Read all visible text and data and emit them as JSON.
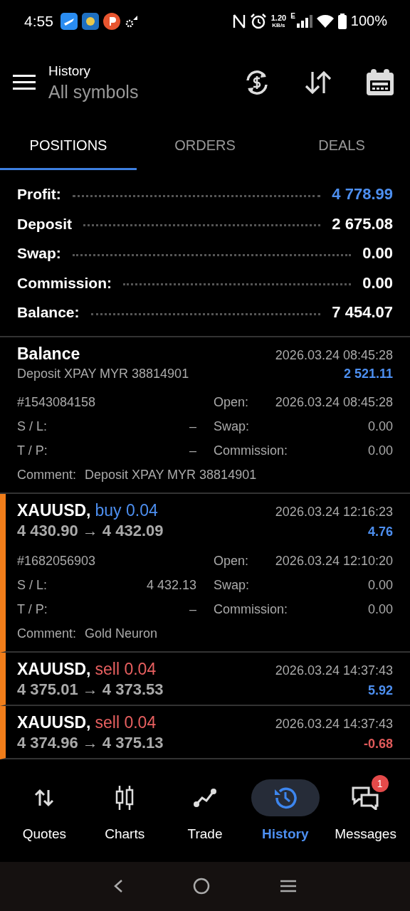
{
  "status_bar": {
    "time": "4:55",
    "speed_value": "1.20",
    "speed_unit": "KB/s",
    "network": "E",
    "battery": "100%"
  },
  "header": {
    "title": "History",
    "subtitle": "All symbols"
  },
  "tabs": [
    {
      "label": "POSITIONS",
      "selected": true
    },
    {
      "label": "ORDERS",
      "selected": false
    },
    {
      "label": "DEALS",
      "selected": false
    }
  ],
  "summary": [
    {
      "label": "Profit:",
      "value": "4 778.99",
      "kind": "profit"
    },
    {
      "label": "Deposit",
      "value": "2 675.08",
      "kind": "plain"
    },
    {
      "label": "Swap:",
      "value": "0.00",
      "kind": "plain"
    },
    {
      "label": "Commission:",
      "value": "0.00",
      "kind": "plain"
    },
    {
      "label": "Balance:",
      "value": "7 454.07",
      "kind": "plain"
    }
  ],
  "entries": [
    {
      "kind": "balance",
      "title": "Balance",
      "time": "2026.03.24 08:45:28",
      "description": "Deposit XPAY MYR 38814901",
      "amount": "2 521.11",
      "loss": false,
      "expanded": true,
      "details": {
        "ticket": "#1543084158",
        "open": {
          "label": "Open:",
          "value": "2026.03.24 08:45:28"
        },
        "sl": {
          "label": "S / L:",
          "value": "–"
        },
        "swap": {
          "label": "Swap:",
          "value": "0.00"
        },
        "tp": {
          "label": "T / P:",
          "value": "–"
        },
        "commission": {
          "label": "Commission:",
          "value": "0.00"
        },
        "comment": {
          "label": "Comment:",
          "value": "Deposit XPAY MYR 38814901"
        }
      }
    },
    {
      "kind": "trade",
      "title": "XAUUSD,",
      "side": {
        "kind": "buy",
        "label": "buy 0.04"
      },
      "time": "2026.03.24 12:16:23",
      "description": "4 430.90 → 4 432.09",
      "amount": "4.76",
      "loss": false,
      "expanded": true,
      "details": {
        "ticket": "#1682056903",
        "open": {
          "label": "Open:",
          "value": "2026.03.24 12:10:20"
        },
        "sl": {
          "label": "S / L:",
          "value": "4 432.13"
        },
        "swap": {
          "label": "Swap:",
          "value": "0.00"
        },
        "tp": {
          "label": "T / P:",
          "value": "–"
        },
        "commission": {
          "label": "Commission:",
          "value": "0.00"
        },
        "comment": {
          "label": "Comment:",
          "value": "Gold Neuron"
        }
      }
    },
    {
      "kind": "trade",
      "title": "XAUUSD,",
      "side": {
        "kind": "sell",
        "label": "sell 0.04"
      },
      "time": "2026.03.24 14:37:43",
      "description": "4 375.01 → 4 373.53",
      "amount": "5.92",
      "loss": false,
      "expanded": false
    },
    {
      "kind": "trade",
      "title": "XAUUSD,",
      "side": {
        "kind": "sell",
        "label": "sell 0.04"
      },
      "time": "2026.03.24 14:37:43",
      "description": "4 374.96 → 4 375.13",
      "amount": "-0.68",
      "loss": true,
      "expanded": false
    }
  ],
  "bottom_nav": [
    {
      "label": "Quotes",
      "selected": false
    },
    {
      "label": "Charts",
      "selected": false
    },
    {
      "label": "Trade",
      "selected": false
    },
    {
      "label": "History",
      "selected": true
    },
    {
      "label": "Messages",
      "selected": false,
      "badge": "1"
    }
  ]
}
